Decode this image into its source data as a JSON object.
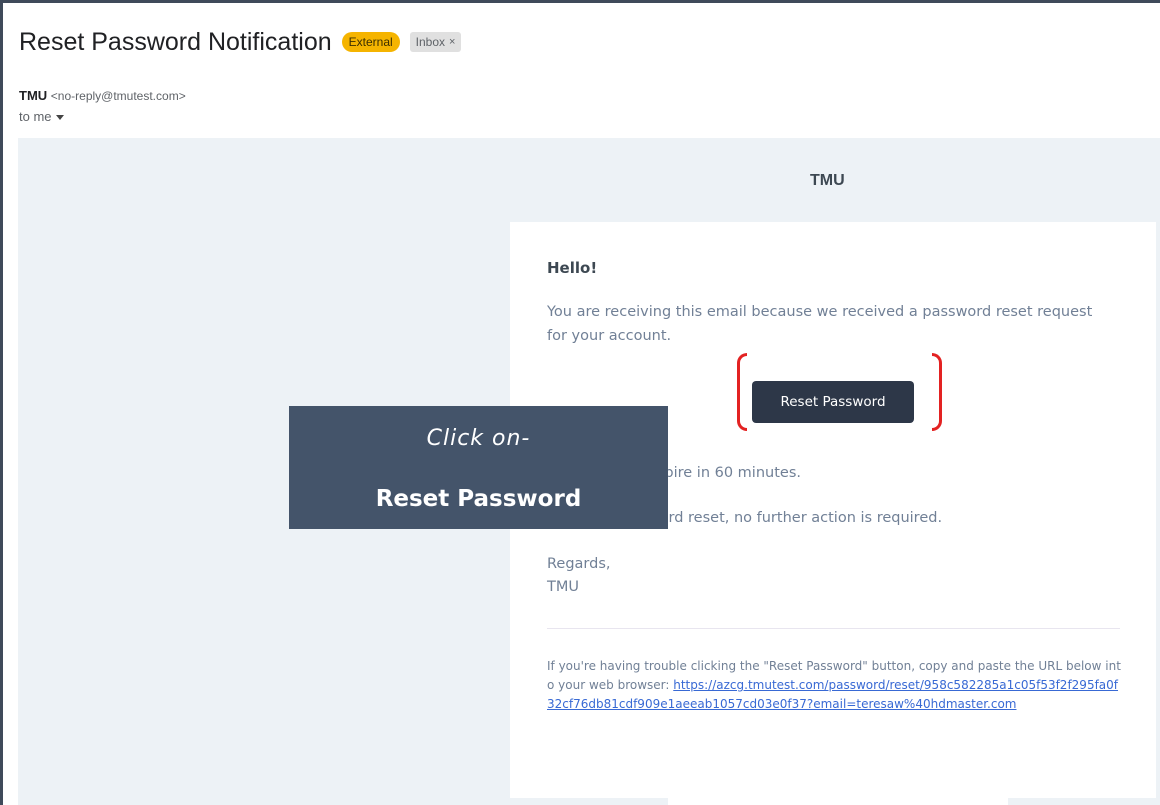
{
  "email": {
    "subject": "Reset Password Notification",
    "labels": {
      "external": "External",
      "inbox": "Inbox",
      "inbox_close": "×"
    },
    "sender_name": "TMU",
    "sender_address": "<no-reply@tmutest.com>",
    "recipient": "to me"
  },
  "body": {
    "brand": "TMU",
    "greeting": "Hello!",
    "intro": "You are receiving this email because we received a password reset request for your account.",
    "button_label": "Reset Password",
    "expire_text": "reset link will expire in 60 minutes.",
    "no_action_text": "equest a password reset, no further action is required.",
    "regards": "Regards,",
    "signature": "TMU",
    "trouble_text": "If you're having trouble clicking the \"Reset Password\" button, copy and paste the URL below into your web browser: ",
    "reset_url": "https://azcg.tmutest.com/password/reset/958c582285a1c05f53f2f295fa0f32cf76db81cdf909e1aeeab1057cd03e0f37?email=teresaw%40hdmaster.com"
  },
  "callout": {
    "line1": "Click on-",
    "line2": "Reset Password"
  },
  "colors": {
    "external_badge": "#f5b400",
    "button": "#2d3748",
    "callout": "#44546a",
    "highlight": "#e32222",
    "link": "#3869d4"
  }
}
